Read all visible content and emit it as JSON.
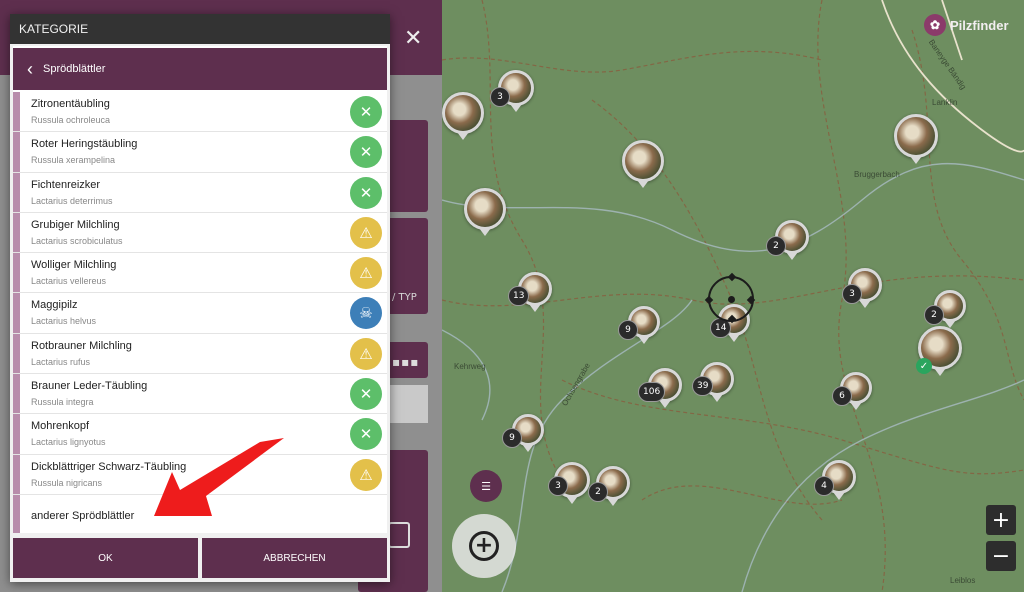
{
  "app": {
    "brand": "Pilzfinder",
    "bg_label_typ": "/ TYP",
    "bg_dots": "▪▪▪",
    "bg_close": "✕"
  },
  "modal": {
    "title": "KATEGORIE",
    "subheader": "Sprödblättler",
    "ok_label": "OK",
    "cancel_label": "ABBRECHEN",
    "other_label": "anderer Sprödblättler"
  },
  "species": [
    {
      "name": "Zitronentäubling",
      "latin": "Russula ochroleuca",
      "status": "edible"
    },
    {
      "name": "Roter Heringstäubling",
      "latin": "Russula xerampelina",
      "status": "edible"
    },
    {
      "name": "Fichtenreizker",
      "latin": "Lactarius deterrimus",
      "status": "edible"
    },
    {
      "name": "Grubiger Milchling",
      "latin": "Lactarius scrobiculatus",
      "status": "warning"
    },
    {
      "name": "Wolliger Milchling",
      "latin": "Lactarius vellereus",
      "status": "warning"
    },
    {
      "name": "Maggipilz",
      "latin": "Lactarius helvus",
      "status": "poisonous"
    },
    {
      "name": "Rotbrauner Milchling",
      "latin": "Lactarius rufus",
      "status": "warning"
    },
    {
      "name": "Brauner Leder-Täubling",
      "latin": "Russula integra",
      "status": "edible"
    },
    {
      "name": "Mohrenkopf",
      "latin": "Lactarius lignyotus",
      "status": "edible"
    },
    {
      "name": "Dickblättriger Schwarz-Täubling",
      "latin": "Russula nigricans",
      "status": "warning"
    }
  ],
  "status_colors": {
    "edible": "#5dbf6a",
    "warning": "#e3c04a",
    "poisonous": "#3d7fb8"
  },
  "map": {
    "places": [
      "Lanklin",
      "Bruggerbach",
      "Kehrweg",
      "Ochsengrabe",
      "Baneyge Bändig",
      "Leiblos"
    ],
    "clusters": [
      "3",
      "2",
      "13",
      "3",
      "2",
      "9",
      "14",
      "106",
      "39",
      "6",
      "9",
      "3",
      "2",
      "4"
    ],
    "zoom_in": "+",
    "zoom_out": "−"
  }
}
